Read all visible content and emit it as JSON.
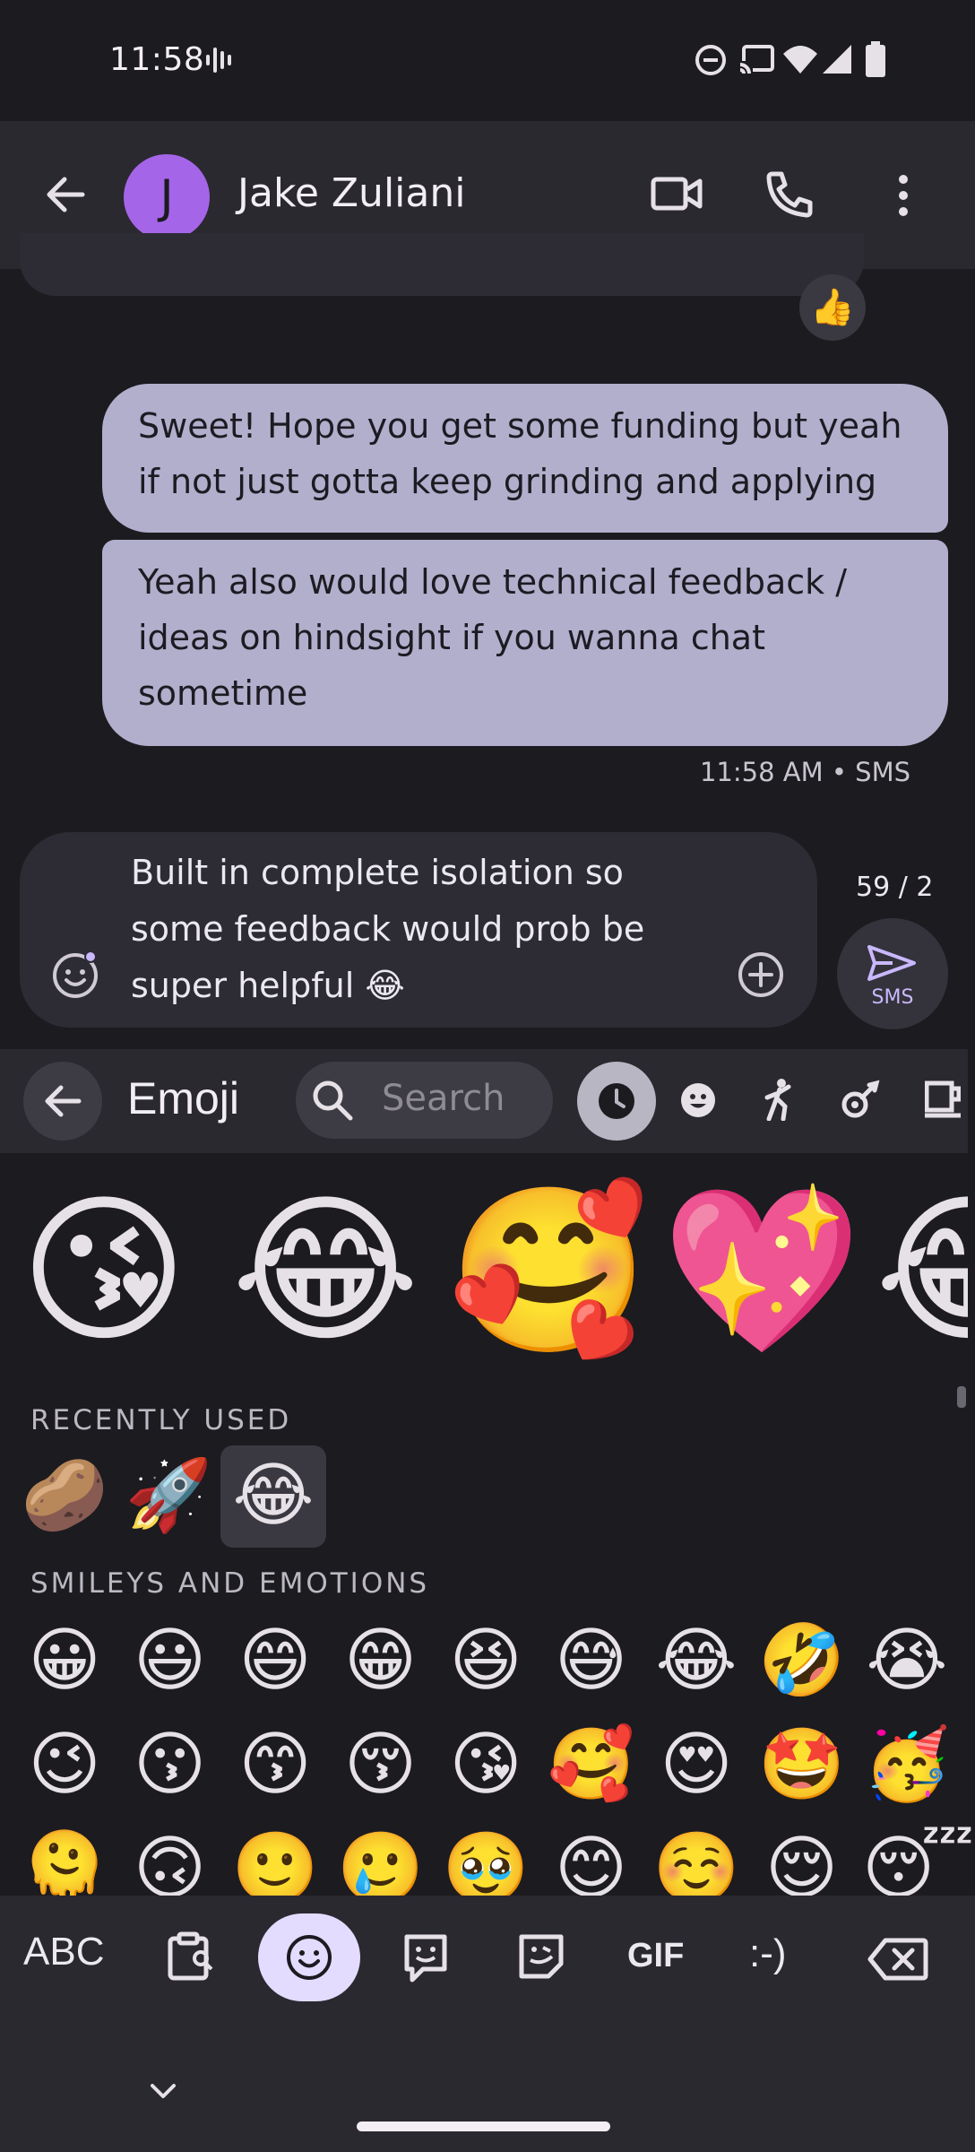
{
  "status_bar": {
    "time": "11:58"
  },
  "header": {
    "avatar_initial": "J",
    "contact_name": "Jake Zuliani"
  },
  "messages": [
    {
      "text": "Sweet! Hope you get some funding but yeah if not just gotta keep grinding and applying"
    },
    {
      "text": "Yeah also would love technical feedback / ideas on hindsight if you wanna chat sometime"
    }
  ],
  "message_meta": "11:58 AM • SMS",
  "reaction": "👍",
  "composer": {
    "text": "Built in complete isolation so some feedback would prob be super helpful 😂",
    "char_count": "59 / 2",
    "send_label": "SMS"
  },
  "emoji_panel": {
    "title": "Emoji",
    "search_placeholder": "Search",
    "suggestions": [
      "😘",
      "😂",
      "🥰",
      "💖",
      "😂"
    ],
    "recently_used_label": "RECENTLY USED",
    "recently_used": [
      "🥔",
      "🚀",
      "😂"
    ],
    "smileys_label": "SMILEYS AND EMOTIONS",
    "smileys_row1": [
      "😀",
      "😃",
      "😄",
      "😁",
      "😆",
      "😅",
      "😂",
      "🤣",
      "😭"
    ],
    "smileys_row2": [
      "😉",
      "😗",
      "😙",
      "😚",
      "😘",
      "🥰",
      "😍",
      "🤩",
      "🥳"
    ],
    "smileys_row3": [
      "🫠",
      "🙃",
      "🙂",
      "🥲",
      "🥹",
      "😊",
      "☺️",
      "😌",
      "😴"
    ]
  },
  "keyboard_bar": {
    "abc_label": "ABC",
    "gif_label": "GIF",
    "emoticon_label": ":-)"
  },
  "colors": {
    "accent": "#a565e8",
    "bubble": "#b2afcd",
    "background": "#1c1b20",
    "panel": "#2a2930"
  }
}
